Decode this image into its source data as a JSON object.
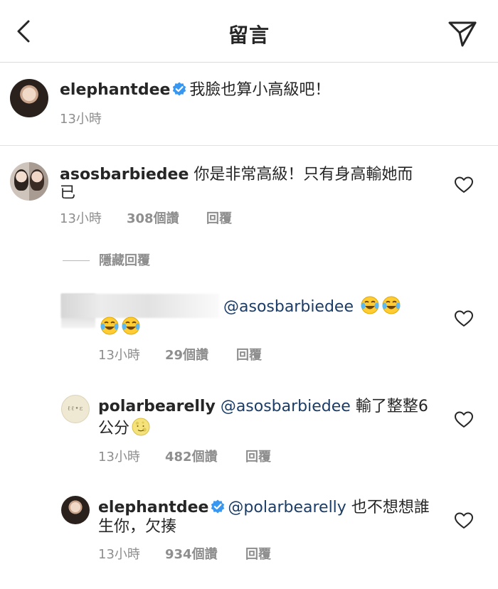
{
  "header": {
    "title": "留言"
  },
  "caption": {
    "username": "elephantdee",
    "text": "我臉也算小高級吧！",
    "time": "13小時"
  },
  "comments": [
    {
      "username": "asosbarbiedee",
      "text_line1": "你是非常高級！只有身高輸她而",
      "text_line2": "已",
      "time": "13小時",
      "likes": "308個讚",
      "reply": "回覆"
    }
  ],
  "hidden_replies": {
    "label": "隱藏回覆"
  },
  "replies": [
    {
      "username": "",
      "mention": "@asosbarbiedee",
      "time": "13小時",
      "likes": "29個讚",
      "reply": "回覆"
    },
    {
      "username": "polarbearelly",
      "mention": "@asosbarbiedee",
      "text_line1": "輸了整整6",
      "text_line2": "公分",
      "avatar_text": "ℓℓ•ɛ",
      "time": "13小時",
      "likes": "482個讚",
      "reply": "回覆"
    },
    {
      "username": "elephantdee",
      "mention": "@polarbearelly",
      "text_line1": "也不想想誰",
      "text_line2": "生你，欠揍",
      "time": "13小時",
      "likes": "934個讚",
      "reply": "回覆"
    }
  ],
  "icons": {
    "back": "chevron-left-icon",
    "share": "paper-plane-icon",
    "verified": "verified-badge-icon",
    "like": "heart-outline-icon",
    "emoji_laugh": "tears-of-joy-emoji",
    "emoji_moon": "full-moon-face-emoji"
  },
  "colors": {
    "verified": "#3897f0",
    "mention": "#1a3c66",
    "meta": "#8e8e8e",
    "text": "#262626"
  }
}
